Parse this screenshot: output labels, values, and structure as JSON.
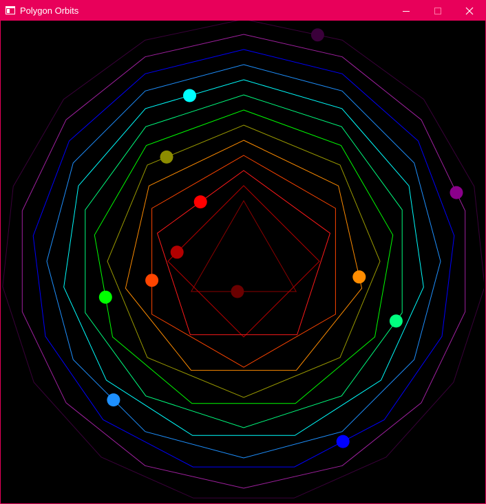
{
  "window": {
    "title": "Polygon Orbits",
    "controls": {
      "minimize": "minimize-icon",
      "maximize": "maximize-icon",
      "close": "close-icon"
    }
  },
  "colors": {
    "titlebar": "#e8005a",
    "background": "#000000"
  },
  "orbits": [
    {
      "sides": 3,
      "color": "#8b0000",
      "ball_color": "#6a0000",
      "ball_phase": 0.52
    },
    {
      "sides": 4,
      "color": "#b30000",
      "ball_color": "#b30000",
      "ball_phase": 0.78
    },
    {
      "sides": 5,
      "color": "#ff1a1a",
      "ball_color": "#ff0000",
      "ball_phase": 0.9
    },
    {
      "sides": 6,
      "color": "#ff4500",
      "ball_color": "#ff4500",
      "ball_phase": 0.72
    },
    {
      "sides": 7,
      "color": "#ff8c00",
      "ball_color": "#ff8c00",
      "ball_phase": 0.27
    },
    {
      "sides": 8,
      "color": "#9a9a00",
      "ball_color": "#8c8c00",
      "ball_phase": 0.9
    },
    {
      "sides": 9,
      "color": "#00ff00",
      "ball_color": "#00ff00",
      "ball_phase": 0.71
    },
    {
      "sides": 10,
      "color": "#00ff7f",
      "ball_color": "#00ff7f",
      "ball_phase": 0.31
    },
    {
      "sides": 11,
      "color": "#00ffff",
      "ball_color": "#00ffff",
      "ball_phase": 0.95
    },
    {
      "sides": 12,
      "color": "#1e90ff",
      "ball_color": "#1e90ff",
      "ball_phase": 0.62
    },
    {
      "sides": 13,
      "color": "#0000ff",
      "ball_color": "#0000ff",
      "ball_phase": 0.42
    },
    {
      "sides": 14,
      "color": "#a020a0",
      "ball_color": "#8b008b",
      "ball_phase": 0.2
    },
    {
      "sides": 15,
      "color": "#3a003a",
      "ball_color": "#3a003a",
      "ball_phase": 0.05
    }
  ]
}
